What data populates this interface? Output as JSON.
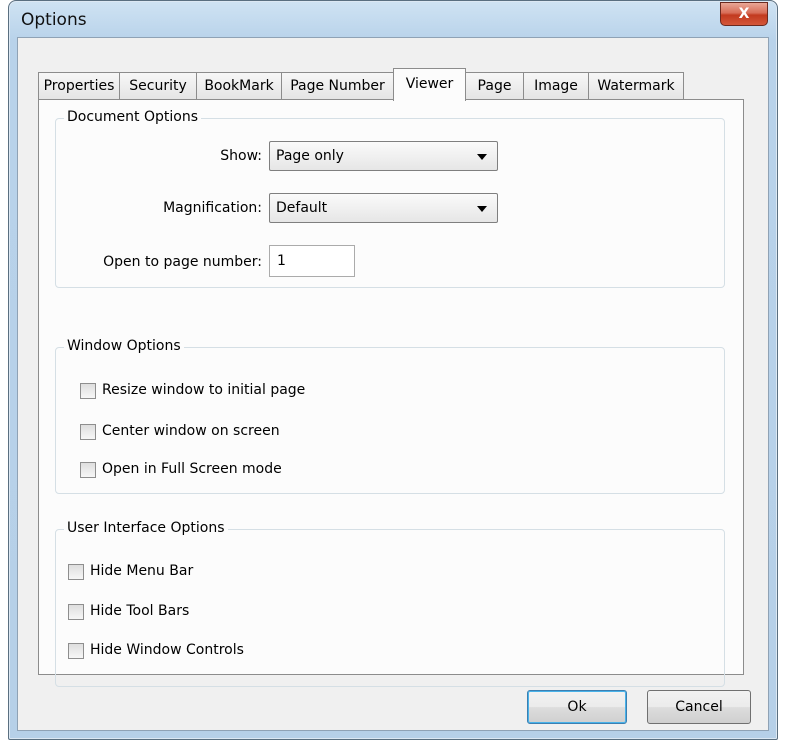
{
  "window": {
    "title": "Options",
    "close_label": "X"
  },
  "tabs": [
    {
      "label": "Properties"
    },
    {
      "label": "Security"
    },
    {
      "label": "BookMark"
    },
    {
      "label": "Page Number"
    },
    {
      "label": "Viewer"
    },
    {
      "label": "Page"
    },
    {
      "label": "Image"
    },
    {
      "label": "Watermark"
    }
  ],
  "active_tab": "Viewer",
  "document_options": {
    "title": "Document Options",
    "show_label": "Show:",
    "show_value": "Page only",
    "magnification_label": "Magnification:",
    "magnification_value": "Default",
    "open_page_label": "Open to page number:",
    "open_page_value": "1"
  },
  "window_options": {
    "title": "Window Options",
    "items": [
      {
        "label": "Resize window to initial page",
        "checked": false
      },
      {
        "label": "Center window on screen",
        "checked": false
      },
      {
        "label": "Open in Full Screen mode",
        "checked": false
      }
    ]
  },
  "ui_options": {
    "title": "User Interface Options",
    "items": [
      {
        "label": "Hide Menu Bar",
        "checked": false
      },
      {
        "label": "Hide Tool Bars",
        "checked": false
      },
      {
        "label": "Hide Window Controls",
        "checked": false
      }
    ]
  },
  "buttons": {
    "ok": "Ok",
    "cancel": "Cancel"
  },
  "colors": {
    "title_bar": "#b8d2ea",
    "close_button": "#c23a1f",
    "dialog_bg": "#f0f0f0",
    "default_button_border": "#3c7fb1"
  }
}
